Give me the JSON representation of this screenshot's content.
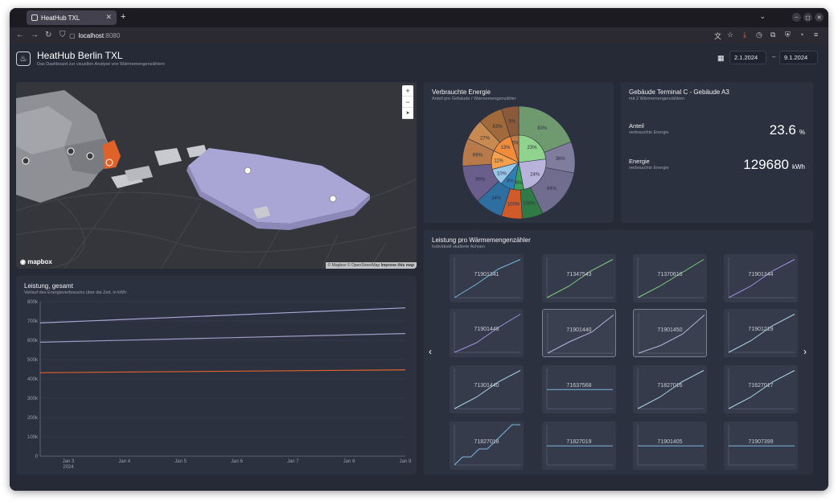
{
  "browser": {
    "tab_title": "HeatHub TXL",
    "new_tab": "+",
    "tab_close": "✕",
    "url_host": "localhost",
    "url_port": ":8080"
  },
  "header": {
    "title": "HeatHub Berlin TXL",
    "subtitle": "Das Dashboard zur visuellen Analyse von Wärmemengenzählern",
    "date_from": "2.1.2024",
    "date_sep": "–",
    "date_to": "9.1.2024"
  },
  "map": {
    "zoom_in": "+",
    "zoom_out": "−",
    "compass": "➤",
    "logo": "mapbox",
    "attribution": "© Mapbox © OpenStreetMap ",
    "improve": "Improve this map"
  },
  "pie": {
    "title": "Verbrauchte Energie",
    "subtitle": "Anteil pro Gebäude / Wärmemengenzähler"
  },
  "stats": {
    "title": "Gebäude Terminal C - Gebäude A3",
    "subtitle": "mit 2 Wärmemengenzählern",
    "share_label": "Anteil",
    "share_sub": "verbrauchte Energie",
    "share_value": "23.6",
    "share_unit": "%",
    "energy_label": "Energie",
    "energy_sub": "verbrauchte Energie",
    "energy_value": "129680",
    "energy_unit": "kWh"
  },
  "gauges": {
    "title": "Leistung, gesamt",
    "subtitle": "Verlauf des Energieverbrauchs über die Zeit, in kWh"
  },
  "meters": {
    "title": "Leistung pro Wärmemengenzähler",
    "subtitle": "Individuell skalierte Achsen",
    "prev": "‹",
    "next": "›",
    "ids": [
      "71901341",
      "71347543",
      "71370616",
      "71901344",
      "71901448",
      "71901440",
      "71901450",
      "71901219",
      "71301440",
      "71637568",
      "71827016",
      "71627017",
      "71827018",
      "71827019",
      "71901405",
      "71907399"
    ],
    "selected": [
      5,
      6
    ]
  },
  "colors": {
    "series_purple_light": "#a9a6d6",
    "series_purple": "#9f9cc8",
    "series_orange": "#e0622a",
    "accent_blue": "#7ab6e0",
    "accent_green": "#7fce7f",
    "accent_violet": "#a08ee0"
  },
  "chart_data": [
    {
      "type": "line",
      "title": "Leistung, gesamt",
      "ylabel": "",
      "ylim": [
        0,
        800000
      ],
      "yticks": [
        "0",
        "100k",
        "200k",
        "300k",
        "400k",
        "500k",
        "600k",
        "700k",
        "800k"
      ],
      "xticks": [
        "Jan 3\n2024",
        "Jan 4",
        "Jan 5",
        "Jan 6",
        "Jan 7",
        "Jan 8",
        "Jan 9"
      ],
      "x": [
        2.5,
        9.0
      ],
      "series": [
        {
          "values": [
            690000,
            768000
          ],
          "color": "#a9a6d6"
        },
        {
          "values": [
            590000,
            635000
          ],
          "color": "#9f9cc8"
        },
        {
          "values": [
            432000,
            447000
          ],
          "color": "#e0622a"
        }
      ]
    },
    {
      "type": "pie",
      "title": "Verbrauchte Energie",
      "inner": [
        {
          "label": "23%",
          "value": 23,
          "color": "#8fd38f"
        },
        {
          "label": "24%",
          "value": 24,
          "color": "#b9b3dc"
        },
        {
          "label": "6%",
          "value": 6,
          "color": "#3aa05a"
        },
        {
          "label": "8%",
          "value": 8,
          "color": "#2e7fb8"
        },
        {
          "label": "10%",
          "value": 10,
          "color": "#9ac7e8"
        },
        {
          "label": "11%",
          "value": 11,
          "color": "#f5a04a"
        },
        {
          "label": "13%",
          "value": 13,
          "color": "#f28c3a"
        },
        {
          "label": "5%",
          "value": 5,
          "color": "#c07a4a"
        }
      ],
      "outer": [
        {
          "label": "83%",
          "value": 19,
          "color": "#6f9a6f"
        },
        {
          "label": "36%",
          "value": 9,
          "color": "#807c9e"
        },
        {
          "label": "64%",
          "value": 15,
          "color": "#706d8f"
        },
        {
          "label": "100%",
          "value": 6,
          "color": "#2f7a45"
        },
        {
          "label": "100%",
          "value": 6,
          "color": "#d05a2a"
        },
        {
          "label": "34%",
          "value": 8,
          "color": "#2e6ea0"
        },
        {
          "label": "86%",
          "value": 11,
          "color": "#6a5f8c"
        },
        {
          "label": "69%",
          "value": 8,
          "color": "#b87a4a"
        },
        {
          "label": "27%",
          "value": 6,
          "color": "#c88a50"
        },
        {
          "label": "63%",
          "value": 7,
          "color": "#a06a3a"
        },
        {
          "label": "5%",
          "value": 5,
          "color": "#8a5a3a"
        }
      ]
    },
    {
      "type": "line",
      "title": "Leistung pro Wärmemengenzähler",
      "series": [
        {
          "name": "71901341",
          "values": [
            0.0,
            0.35,
            0.75,
            1.0
          ],
          "color": "#7ab6e0"
        },
        {
          "name": "71347543",
          "values": [
            0.0,
            0.3,
            0.7,
            1.0
          ],
          "color": "#7fce7f"
        },
        {
          "name": "71370616",
          "values": [
            0.0,
            0.3,
            0.65,
            1.0
          ],
          "color": "#7fce7f"
        },
        {
          "name": "71901344",
          "values": [
            0.0,
            0.3,
            0.7,
            1.0
          ],
          "color": "#a08ee0"
        },
        {
          "name": "71901448",
          "values": [
            0.0,
            0.25,
            0.65,
            1.0
          ],
          "color": "#a08ee0"
        },
        {
          "name": "71901440",
          "values": [
            0.0,
            0.3,
            0.55,
            1.0
          ],
          "color": "#b9b3dc"
        },
        {
          "name": "71901450",
          "values": [
            0.0,
            0.2,
            0.5,
            1.0
          ],
          "color": "#b9b3dc"
        },
        {
          "name": "71901219",
          "values": [
            0.0,
            0.3,
            0.7,
            1.0
          ],
          "color": "#a8d8ea"
        },
        {
          "name": "71301440",
          "values": [
            0.0,
            0.3,
            0.7,
            1.0
          ],
          "color": "#a8d8ea"
        },
        {
          "name": "71637568",
          "values": [
            0.5,
            0.5,
            0.5,
            0.5
          ],
          "color": "#7ab6e0"
        },
        {
          "name": "71827016",
          "values": [
            0.0,
            0.3,
            0.7,
            1.0
          ],
          "color": "#a8d8ea"
        },
        {
          "name": "71627017",
          "values": [
            0.0,
            0.3,
            0.7,
            1.0
          ],
          "color": "#a8d8ea"
        },
        {
          "name": "71827018",
          "values": [
            0.0,
            0.2,
            0.2,
            0.4,
            0.4,
            0.6,
            0.8,
            1.0,
            1.0
          ],
          "color": "#7ab6e0"
        },
        {
          "name": "71827019",
          "values": [
            0.5,
            0.5,
            0.5,
            0.5
          ],
          "color": "#7ab6e0"
        },
        {
          "name": "71901405",
          "values": [
            0.5,
            0.5,
            0.5,
            0.5
          ],
          "color": "#7ab6e0"
        },
        {
          "name": "71907399",
          "values": [
            0.5,
            0.5,
            0.5,
            0.5
          ],
          "color": "#7ab6e0"
        }
      ]
    }
  ]
}
